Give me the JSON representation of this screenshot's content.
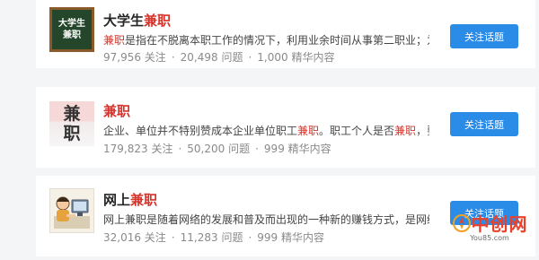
{
  "topics": [
    {
      "title_prefix": "大学生",
      "title_highlight": "兼职",
      "title_suffix": "",
      "thumb_lines": [
        "大学生",
        "兼职"
      ],
      "desc_parts": [
        {
          "text": "兼职",
          "hl": true
        },
        {
          "text": "是指在不脱离本职工作的情况下，利用业余时间从事第二职业；为第",
          "hl": false
        }
      ],
      "followers": "97,956 关注",
      "questions": "20,498 问题",
      "featured": "1,000 精华内容",
      "button_label": "关注话题"
    },
    {
      "title_prefix": "",
      "title_highlight": "兼职",
      "title_suffix": "",
      "thumb_lines": [
        "兼",
        "职"
      ],
      "desc_parts": [
        {
          "text": "企业、单位并不特别赞成本企业单位职工",
          "hl": false
        },
        {
          "text": "兼职",
          "hl": true
        },
        {
          "text": "。职工个人是否",
          "hl": false
        },
        {
          "text": "兼职",
          "hl": true
        },
        {
          "text": "，要看",
          "hl": false
        }
      ],
      "followers": "179,823 关注",
      "questions": "50,200 问题",
      "featured": "999 精华内容",
      "button_label": "关注话题"
    },
    {
      "title_prefix": "网上",
      "title_highlight": "兼职",
      "title_suffix": "",
      "thumb_lines": [],
      "desc_parts": [
        {
          "text": "网上兼职是随着网络的发展和普及而出现的一种新的赚钱方式，是网络时",
          "hl": false
        }
      ],
      "followers": "32,016 关注",
      "questions": "11,283 问题",
      "featured": "999 精华内容",
      "button_label": "关注话题"
    }
  ],
  "separator": "·",
  "watermark": {
    "name": "中创网",
    "domain": "You85.com",
    "icon": "rocket-circle-icon",
    "color": "#e8422c"
  },
  "colors": {
    "accent": "#2b8ce7",
    "highlight": "#d7342c"
  }
}
